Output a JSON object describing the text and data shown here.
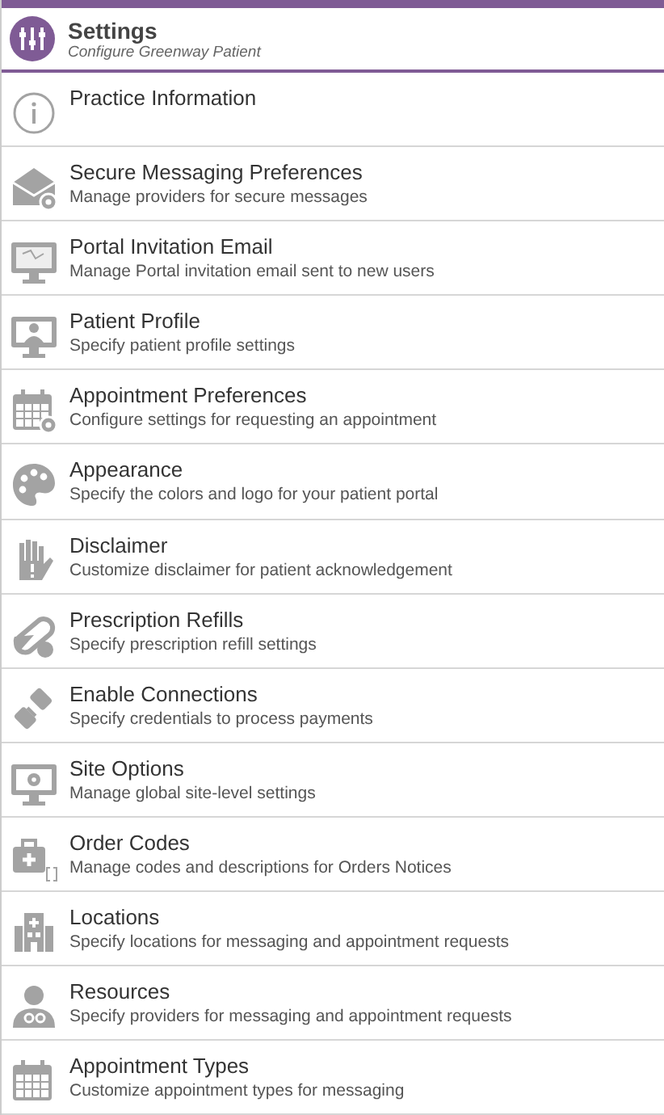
{
  "header": {
    "title": "Settings",
    "subtitle": "Configure Greenway Patient"
  },
  "items": [
    {
      "title": "Practice Information"
    },
    {
      "title": "Secure Messaging Preferences",
      "subtitle": "Manage providers for secure messages"
    },
    {
      "title": "Portal Invitation Email",
      "subtitle": "Manage Portal invitation email sent to new users"
    },
    {
      "title": "Patient Profile",
      "subtitle": "Specify patient profile settings"
    },
    {
      "title": "Appointment Preferences",
      "subtitle": "Configure settings for requesting an appointment"
    },
    {
      "title": "Appearance",
      "subtitle": "Specify the colors and logo for your patient portal"
    },
    {
      "title": "Disclaimer",
      "subtitle": "Customize disclaimer for patient acknowledgement"
    },
    {
      "title": "Prescription Refills",
      "subtitle": "Specify prescription refill settings"
    },
    {
      "title": "Enable Connections",
      "subtitle": "Specify credentials to process payments"
    },
    {
      "title": "Site Options",
      "subtitle": "Manage global site-level settings"
    },
    {
      "title": "Order Codes",
      "subtitle": "Manage codes and descriptions for Orders Notices"
    },
    {
      "title": "Locations",
      "subtitle": "Specify locations for messaging and appointment requests"
    },
    {
      "title": "Resources",
      "subtitle": "Specify providers for messaging and appointment requests"
    },
    {
      "title": "Appointment Types",
      "subtitle": "Customize appointment types for messaging"
    }
  ]
}
